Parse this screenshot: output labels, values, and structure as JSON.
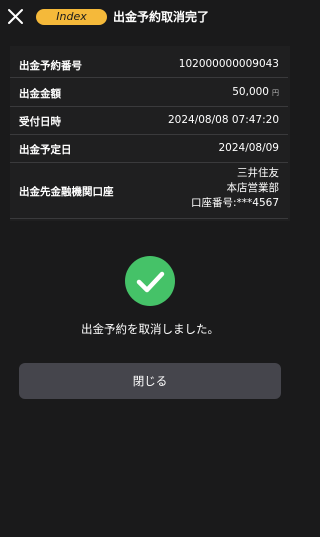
{
  "header": {
    "close_icon": "close-icon",
    "index_badge": "Index",
    "title": "出金予約取消完了"
  },
  "details": {
    "rows": [
      {
        "label": "出金予約番号",
        "value": "102000000009043"
      },
      {
        "label": "出金金額",
        "value": "50,000",
        "unit": "円"
      },
      {
        "label": "受付日時",
        "value": "2024/08/08 07:47:20"
      },
      {
        "label": "出金予定日",
        "value": "2024/08/09"
      },
      {
        "label": "出金先金融機関口座",
        "bank": "三井住友",
        "branch": "本店営業部",
        "account": "口座番号:***4567"
      }
    ]
  },
  "status": {
    "icon": "check-circle-icon",
    "message": "出金予約を取消しました。"
  },
  "actions": {
    "close_label": "閉じる"
  },
  "colors": {
    "background": "#1a1a1b",
    "panel": "#1f1f20",
    "badge": "#f5b93a",
    "success": "#45c268",
    "button": "#45454c",
    "divider": "#3a3a3c"
  }
}
